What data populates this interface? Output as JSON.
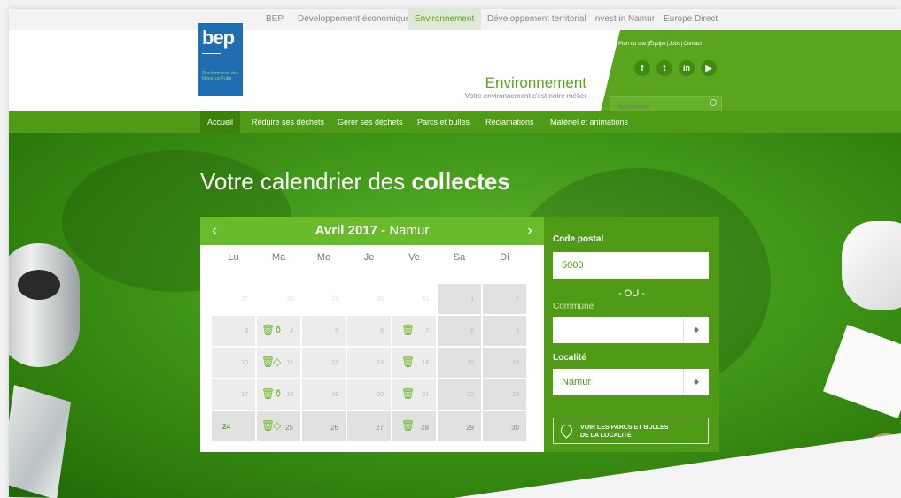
{
  "top_nav": [
    "BEP",
    "Développement économique",
    "Environnement",
    "Développement territorial",
    "Invest in Namur",
    "Europe Direct"
  ],
  "logo": {
    "word": "bep",
    "tagline": "Des Hommes, des Idées, un Futur"
  },
  "header": {
    "title": "Environnement",
    "subtitle": "Votre environnement c'est notre métier"
  },
  "utility_links": [
    "Plan du site",
    "Équipe",
    "Jobs",
    "Contact"
  ],
  "social": [
    "f",
    "t",
    "in",
    "yt"
  ],
  "search": {
    "placeholder": "Rechercher"
  },
  "main_menu": [
    "Accueil",
    "Réduire ses déchets",
    "Gérer ses déchets",
    "Parcs et bulles",
    "Réclamations",
    "Matériel et animations"
  ],
  "hero": {
    "title_prefix": "Votre calendrier des ",
    "title_bold": "collectes"
  },
  "calendar": {
    "month": "Avril 2017",
    "place": " - Namur",
    "prev": "‹",
    "next": "›",
    "weekdays": [
      "Lu",
      "Ma",
      "Me",
      "Je",
      "Ve",
      "Sa",
      "Di"
    ],
    "weeks": [
      [
        "27",
        "28",
        "29",
        "30",
        "31",
        "1",
        "2"
      ],
      [
        "3",
        "4",
        "5",
        "6",
        "7",
        "8",
        "9"
      ],
      [
        "10",
        "11",
        "12",
        "13",
        "14",
        "15",
        "16"
      ],
      [
        "17",
        "18",
        "19",
        "20",
        "21",
        "22",
        "23"
      ],
      [
        "24",
        "25",
        "26",
        "27",
        "28",
        "29",
        "30"
      ]
    ]
  },
  "form": {
    "postal_label": "Code postal",
    "postal_value": "5000",
    "or": "- OU -",
    "commune_label": "Commune",
    "commune_value": "",
    "locality_label": "Localité",
    "locality_value": "Namur",
    "button_line1": "VOIR LES PARCS ET BULLES",
    "button_line2": "DE LA LOCALITÉ"
  },
  "colors": {
    "brand_green": "#5aa51d",
    "dark_green": "#4f9a16",
    "bep_blue": "#1f6db3"
  }
}
